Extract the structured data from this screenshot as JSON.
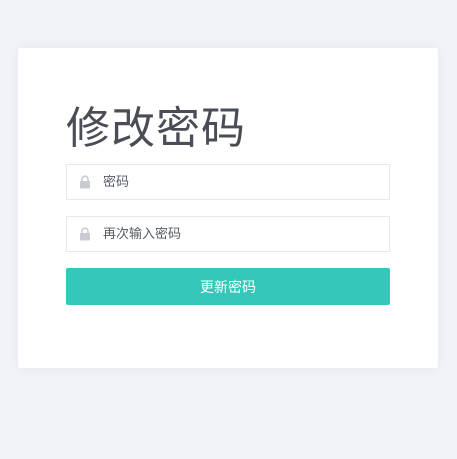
{
  "page": {
    "title": "修改密码"
  },
  "form": {
    "password": {
      "placeholder": "密码",
      "value": "",
      "icon": "lock-icon"
    },
    "confirm_password": {
      "placeholder": "再次输入密码",
      "value": "",
      "icon": "lock-icon"
    },
    "submit_label": "更新密码"
  },
  "colors": {
    "page_background": "#f2f3f8",
    "card_background": "#ffffff",
    "accent": "#34c8b8",
    "title_text": "#4a4d55",
    "icon": "#c8cbd2"
  }
}
